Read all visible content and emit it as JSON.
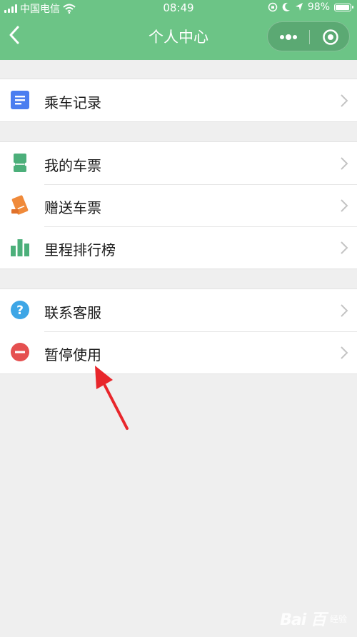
{
  "status_bar": {
    "carrier": "中国电信",
    "time": "08:49",
    "battery": "98%",
    "icons": [
      "signal-icon",
      "wifi-icon",
      "rotation-lock-icon",
      "moon-icon",
      "location-icon",
      "battery-icon"
    ]
  },
  "nav": {
    "title": "个人中心",
    "back_icon": "chevron-left-icon",
    "more_icon": "more-dots-icon",
    "close_icon": "target-close-icon"
  },
  "groups": [
    {
      "items": [
        {
          "label": "乘车记录",
          "icon": "document-icon",
          "color": "#4b7ef0"
        }
      ]
    },
    {
      "items": [
        {
          "label": "我的车票",
          "icon": "ticket-icon",
          "color": "#4caf7a"
        },
        {
          "label": "赠送车票",
          "icon": "gift-ticket-icon",
          "color": "#f08a3a"
        },
        {
          "label": "里程排行榜",
          "icon": "bar-chart-icon",
          "color": "#4caf7a"
        }
      ]
    },
    {
      "items": [
        {
          "label": "联系客服",
          "icon": "question-icon",
          "color": "#3ea6e6"
        },
        {
          "label": "暂停使用",
          "icon": "minus-circle-icon",
          "color": "#e55050"
        }
      ]
    }
  ],
  "annotation": {
    "color": "#e8262b"
  },
  "watermark": {
    "logo": "Bai 百",
    "site": "经验"
  },
  "colors": {
    "header_bg": "#6cc486",
    "page_bg": "#efefef"
  }
}
